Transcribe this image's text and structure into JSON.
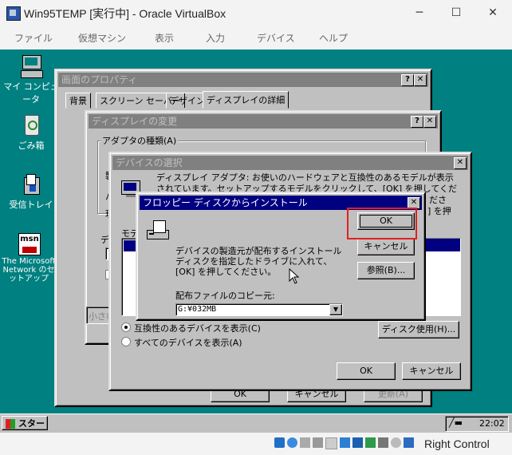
{
  "host": {
    "title": "Win95TEMP [実行中] - Oracle VirtualBox",
    "menu": [
      "ファイル",
      "仮想マシン",
      "表示",
      "入力",
      "デバイス",
      "ヘルプ"
    ],
    "status_text": "Right Control"
  },
  "desktop": {
    "icons": [
      "マイ コンピュータ",
      "ごみ箱",
      "受信トレイ",
      "The Microsoft Network のセットアップ"
    ]
  },
  "display_props": {
    "title": "画面のプロパティ",
    "tabs": [
      "背景",
      "スクリーン セーバー",
      "デザイン",
      "ディスプレイの詳細"
    ],
    "ok": "OK",
    "cancel": "キャンセル",
    "apply": "更新(A)"
  },
  "change_display": {
    "title": "ディスプレイの変更",
    "adapter_group": "アダプタの種類(A)",
    "frag_small": "小さい"
  },
  "select_device": {
    "title": "デバイスの選択",
    "description": "ディスプレイ アダプタ:  お使いのハードウェアと互換性のあるモデルが表示されています。セットアップするモデルをクリックして、[OK] を押してください。",
    "desc_tail": "ださ",
    "desc_tail2": "] を押",
    "models_label": "モデ",
    "radio_compatible": "互換性のあるデバイスを表示(C)",
    "radio_all": "すべてのデバイスを表示(A)",
    "have_disk": "ディスク使用(H)...",
    "ok": "OK",
    "cancel": "キャンセル"
  },
  "floppy": {
    "title": "フロッピー ディスクからインストール",
    "message": "デバイスの製造元が配布するインストール ディスクを指定したドライブに入れて、[OK] を押してください。",
    "copy_label": "配布ファイルのコピー元:",
    "copy_value": "G:¥032MB",
    "ok": "OK",
    "cancel": "キャンセル",
    "browse": "参照(B)..."
  },
  "taskbar": {
    "start": "スタート",
    "clock": "22:02"
  }
}
